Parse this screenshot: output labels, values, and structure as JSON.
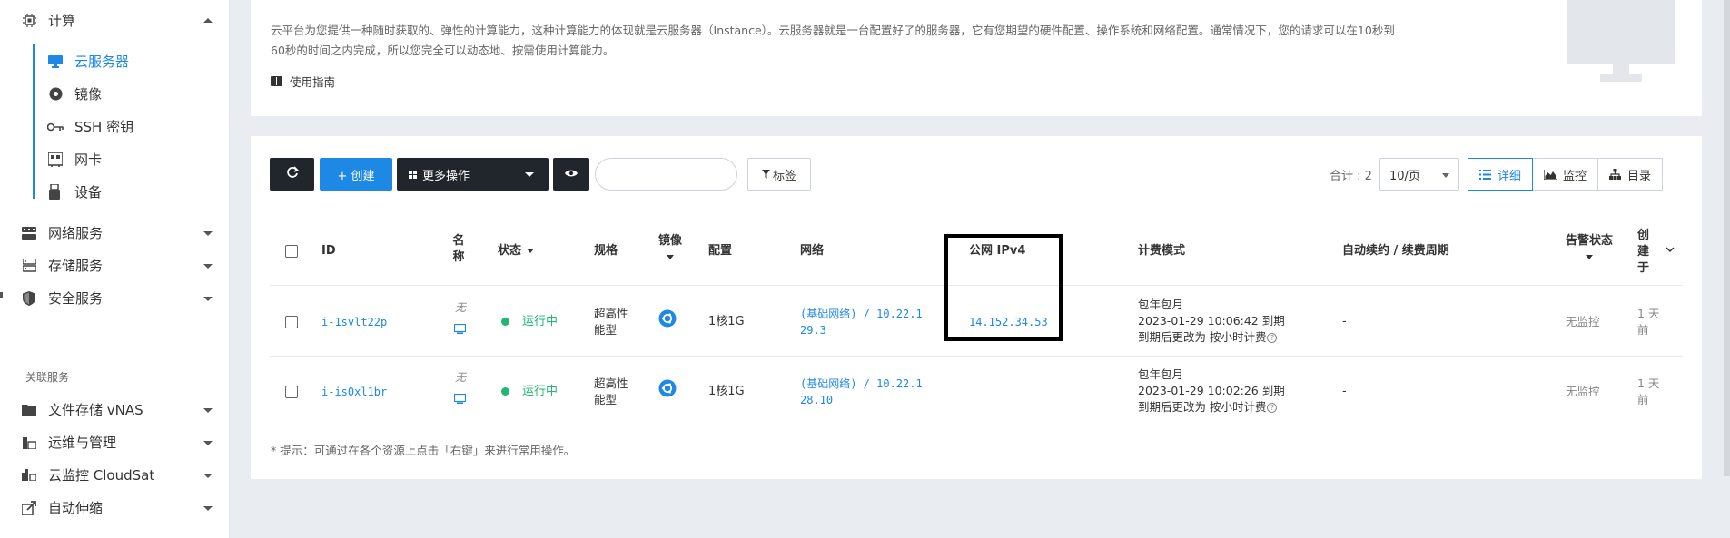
{
  "sidebar": {
    "compute": {
      "label": "计算"
    },
    "compute_items": [
      {
        "label": "云服务器",
        "icon": "monitor-icon"
      },
      {
        "label": "镜像",
        "icon": "disc-icon"
      },
      {
        "label": "SSH 密钥",
        "icon": "key-icon"
      },
      {
        "label": "网卡",
        "icon": "network-card-icon"
      },
      {
        "label": "设备",
        "icon": "usb-device-icon"
      }
    ],
    "groups": [
      {
        "label": "网络服务",
        "icon": "network-icon"
      },
      {
        "label": "存储服务",
        "icon": "storage-icon"
      },
      {
        "label": "安全服务",
        "icon": "shield-icon"
      }
    ],
    "related_label": "关联服务",
    "related": [
      {
        "label": "文件存储 vNAS",
        "icon": "folder-icon"
      },
      {
        "label": "运维与管理",
        "icon": "ops-icon"
      },
      {
        "label": "云监控 CloudSat",
        "icon": "monitor-chart-icon"
      },
      {
        "label": "自动伸缩",
        "icon": "autoscale-icon"
      }
    ]
  },
  "intro": {
    "line1": "云平台为您提供一种随时获取的、弹性的计算能力，这种计算能力的体现就是云服务器（Instance）。云服务器就是一台配置好了的服务器，它有您期望的硬件配置、操作系统和网络配置。通常情况下，您的请求可以在10秒到",
    "line2": "60秒的时间之内完成，所以您完全可以动态地、按需使用计算能力。",
    "guide": "使用指南"
  },
  "toolbar": {
    "create": "+ 创建",
    "more": "更多操作",
    "tags": "标签",
    "search_value": "",
    "total": "合计 : 2",
    "page_size": "10/页",
    "views": [
      "详细",
      "监控",
      "目录"
    ]
  },
  "table": {
    "headers": {
      "id": "ID",
      "name": "名称",
      "status": "状态",
      "spec": "规格",
      "image": "镜像",
      "config": "配置",
      "network": "网络",
      "public_ip": "公网 IPv4",
      "billing": "计费模式",
      "auto_renew": "自动续约 / 续费周期",
      "alarm": "告警状态",
      "created": "创建于"
    },
    "rows": [
      {
        "id": "i-1svlt22p",
        "name": "无",
        "status": "运行中",
        "spec": "超高性能型",
        "config": "1核1G",
        "network_line1": "(基础网络) / 10.22.1",
        "network_line2": "29.3",
        "public_ip": "14.152.34.53",
        "billing_line1": "包年包月",
        "billing_line2": "2023-01-29 10:06:42 到期",
        "billing_line3": "到期后更改为 按小时计费",
        "auto_renew": "-",
        "alarm": "无监控",
        "created": "1 天前"
      },
      {
        "id": "i-is0xl1br",
        "name": "无",
        "status": "运行中",
        "spec": "超高性能型",
        "config": "1核1G",
        "network_line1": "(基础网络) / 10.22.1",
        "network_line2": "28.10",
        "public_ip": "",
        "billing_line1": "包年包月",
        "billing_line2": "2023-01-29 10:02:26 到期",
        "billing_line3": "到期后更改为 按小时计费",
        "auto_renew": "-",
        "alarm": "无监控",
        "created": "1 天前"
      }
    ]
  },
  "tip": "* 提示：可通过在各个资源上点击「右键」来进行常用操作。",
  "colors": {
    "accent": "#1e88e5",
    "running": "#22b573",
    "dark_button": "#21262d"
  }
}
